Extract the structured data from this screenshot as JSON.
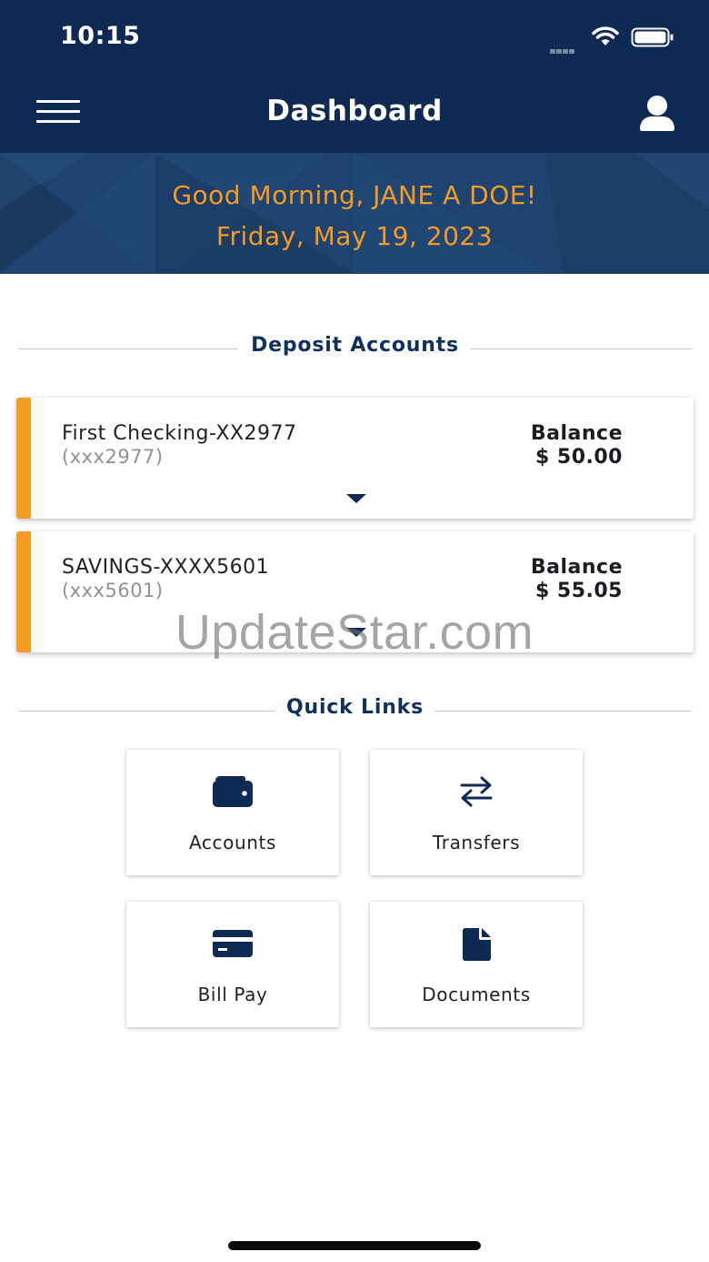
{
  "colors": {
    "header_bg": "#0f2a52",
    "accent_orange": "#f39b24",
    "navy_text": "#12305c",
    "icon_navy": "#0f2a52"
  },
  "status_bar": {
    "time": "10:15",
    "icons": [
      "cellular-signal-icon",
      "wifi-icon",
      "battery-icon"
    ]
  },
  "header": {
    "title": "Dashboard",
    "menu_icon": "hamburger-menu-icon",
    "profile_icon": "user-profile-icon",
    "greeting": "Good Morning, JANE A DOE!",
    "date": "Friday, May 19, 2023"
  },
  "deposit_accounts": {
    "heading": "Deposit Accounts",
    "accounts": [
      {
        "name": "First Checking-XX2977",
        "number": "(xxx2977)",
        "balance_label": "Balance",
        "balance": "$ 50.00",
        "expand_icon": "caret-down-icon"
      },
      {
        "name": "SAVINGS-XXXX5601",
        "number": "(xxx5601)",
        "balance_label": "Balance",
        "balance": "$ 55.05",
        "expand_icon": "caret-down-icon"
      }
    ]
  },
  "quick_links": {
    "heading": "Quick Links",
    "items": [
      {
        "label": "Accounts",
        "icon": "wallet-icon"
      },
      {
        "label": "Transfers",
        "icon": "transfer-arrows-icon"
      },
      {
        "label": "Bill Pay",
        "icon": "credit-card-icon"
      },
      {
        "label": "Documents",
        "icon": "document-icon"
      }
    ]
  },
  "watermark": "UpdateStar.com"
}
